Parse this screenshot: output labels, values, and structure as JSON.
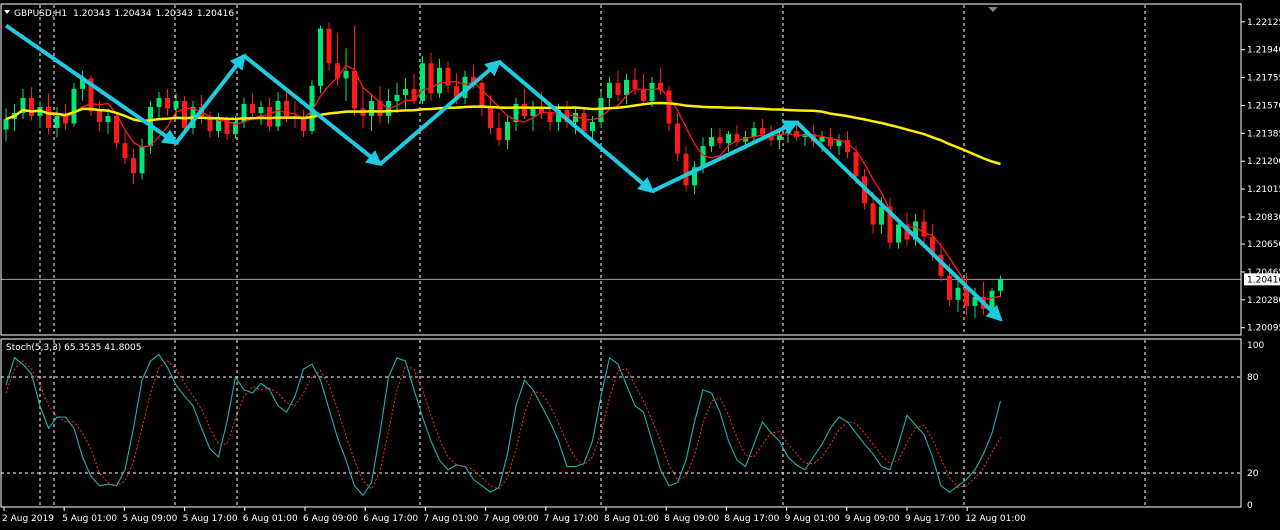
{
  "chart_data": [
    {
      "type": "candlestick",
      "title": "GBPUSD,H1",
      "ohlc_header": [
        "1.20343",
        "1.20434",
        "1.20343",
        "1.20416"
      ],
      "current_price": 1.20416,
      "current_price_label": "1.20416",
      "ylim": [
        1.2006,
        1.2223
      ],
      "y_ticks": [
        {
          "v": 1.22125,
          "label": "1.22125"
        },
        {
          "v": 1.2194,
          "label": "1.21940"
        },
        {
          "v": 1.21755,
          "label": "1.21755"
        },
        {
          "v": 1.2157,
          "label": "1.21570"
        },
        {
          "v": 1.21385,
          "label": "1.21385"
        },
        {
          "v": 1.212,
          "label": "1.21200"
        },
        {
          "v": 1.21015,
          "label": "1.21015"
        },
        {
          "v": 1.2083,
          "label": "1.20830"
        },
        {
          "v": 1.2065,
          "label": "1.20650"
        },
        {
          "v": 1.20465,
          "label": "1.20465"
        },
        {
          "v": 1.2028,
          "label": "1.20280"
        },
        {
          "v": 1.20095,
          "label": "1.20095"
        }
      ],
      "x_labels": [
        "2 Aug 2019",
        "5 Aug 01:00",
        "5 Aug 09:00",
        "5 Aug 17:00",
        "6 Aug 01:00",
        "6 Aug 09:00",
        "6 Aug 17:00",
        "7 Aug 01:00",
        "7 Aug 09:00",
        "7 Aug 17:00",
        "8 Aug 01:00",
        "8 Aug 09:00",
        "8 Aug 17:00",
        "9 Aug 01:00",
        "9 Aug 09:00",
        "9 Aug 17:00",
        "12 Aug 01:00"
      ],
      "candles": [
        [
          1.2141,
          1.2155,
          1.2133,
          1.2148
        ],
        [
          1.2148,
          1.2158,
          1.214,
          1.2152
        ],
        [
          1.2152,
          1.2168,
          1.2148,
          1.2162
        ],
        [
          1.2162,
          1.2169,
          1.2147,
          1.215
        ],
        [
          1.215,
          1.216,
          1.2142,
          1.2156
        ],
        [
          1.2156,
          1.2165,
          1.2138,
          1.2142
        ],
        [
          1.2142,
          1.2156,
          1.2136,
          1.215
        ],
        [
          1.215,
          1.2158,
          1.2141,
          1.2145
        ],
        [
          1.2145,
          1.2172,
          1.2143,
          1.2168
        ],
        [
          1.2168,
          1.218,
          1.216,
          1.2175
        ],
        [
          1.2175,
          1.2177,
          1.215,
          1.2153
        ],
        [
          1.2153,
          1.216,
          1.214,
          1.2146
        ],
        [
          1.2146,
          1.2155,
          1.2138,
          1.215
        ],
        [
          1.215,
          1.2152,
          1.2128,
          1.2132
        ],
        [
          1.2132,
          1.214,
          1.2118,
          1.2122
        ],
        [
          1.2122,
          1.2128,
          1.2105,
          1.2112
        ],
        [
          1.2112,
          1.2135,
          1.2108,
          1.213
        ],
        [
          1.213,
          1.216,
          1.2125,
          1.2156
        ],
        [
          1.2156,
          1.2166,
          1.2148,
          1.2162
        ],
        [
          1.2162,
          1.2168,
          1.215,
          1.2155
        ],
        [
          1.2155,
          1.2165,
          1.2148,
          1.216
        ],
        [
          1.216,
          1.2163,
          1.2138,
          1.2142
        ],
        [
          1.2142,
          1.216,
          1.2138,
          1.2156
        ],
        [
          1.2156,
          1.2164,
          1.2145,
          1.215
        ],
        [
          1.215,
          1.2153,
          1.2136,
          1.214
        ],
        [
          1.214,
          1.2152,
          1.2136,
          1.2148
        ],
        [
          1.2148,
          1.215,
          1.2134,
          1.2138
        ],
        [
          1.2138,
          1.215,
          1.2135,
          1.2146
        ],
        [
          1.2146,
          1.2162,
          1.2142,
          1.2158
        ],
        [
          1.2158,
          1.2165,
          1.2148,
          1.2152
        ],
        [
          1.2152,
          1.216,
          1.2144,
          1.2156
        ],
        [
          1.2156,
          1.2162,
          1.214,
          1.2143
        ],
        [
          1.2143,
          1.2166,
          1.214,
          1.216
        ],
        [
          1.216,
          1.2166,
          1.2146,
          1.215
        ],
        [
          1.215,
          1.216,
          1.2142,
          1.2148
        ],
        [
          1.2148,
          1.2154,
          1.2136,
          1.214
        ],
        [
          1.214,
          1.2174,
          1.2138,
          1.217
        ],
        [
          1.217,
          1.221,
          1.2165,
          1.2208
        ],
        [
          1.2208,
          1.2212,
          1.218,
          1.2185
        ],
        [
          1.2185,
          1.2205,
          1.217,
          1.2175
        ],
        [
          1.2175,
          1.2195,
          1.216,
          1.218
        ],
        [
          1.218,
          1.221,
          1.215,
          1.2155
        ],
        [
          1.2155,
          1.217,
          1.2142,
          1.215
        ],
        [
          1.215,
          1.2165,
          1.214,
          1.216
        ],
        [
          1.216,
          1.217,
          1.2145,
          1.215
        ],
        [
          1.215,
          1.2168,
          1.2145,
          1.216
        ],
        [
          1.216,
          1.2172,
          1.2152,
          1.2164
        ],
        [
          1.2164,
          1.2175,
          1.2155,
          1.2168
        ],
        [
          1.2168,
          1.2178,
          1.2158,
          1.216
        ],
        [
          1.216,
          1.219,
          1.2158,
          1.2185
        ],
        [
          1.2185,
          1.2192,
          1.216,
          1.2165
        ],
        [
          1.2165,
          1.2188,
          1.2162,
          1.2182
        ],
        [
          1.2182,
          1.2186,
          1.2165,
          1.217
        ],
        [
          1.217,
          1.2178,
          1.2158,
          1.2162
        ],
        [
          1.2162,
          1.218,
          1.2158,
          1.2176
        ],
        [
          1.2176,
          1.2184,
          1.2168,
          1.2172
        ],
        [
          1.2172,
          1.2176,
          1.215,
          1.2156
        ],
        [
          1.2156,
          1.2164,
          1.2138,
          1.2142
        ],
        [
          1.2142,
          1.2152,
          1.213,
          1.2134
        ],
        [
          1.2134,
          1.215,
          1.2128,
          1.2146
        ],
        [
          1.2146,
          1.2162,
          1.214,
          1.2158
        ],
        [
          1.2158,
          1.2168,
          1.2148,
          1.215
        ],
        [
          1.215,
          1.216,
          1.214,
          1.2156
        ],
        [
          1.2156,
          1.2166,
          1.2148,
          1.2152
        ],
        [
          1.2152,
          1.2158,
          1.214,
          1.2146
        ],
        [
          1.2146,
          1.2158,
          1.214,
          1.2154
        ],
        [
          1.2154,
          1.216,
          1.2142,
          1.2146
        ],
        [
          1.2146,
          1.2156,
          1.2138,
          1.2152
        ],
        [
          1.2152,
          1.2155,
          1.2136,
          1.214
        ],
        [
          1.214,
          1.215,
          1.2134,
          1.2146
        ],
        [
          1.2146,
          1.2166,
          1.2142,
          1.2162
        ],
        [
          1.2162,
          1.2176,
          1.2156,
          1.2172
        ],
        [
          1.2172,
          1.218,
          1.216,
          1.2164
        ],
        [
          1.2164,
          1.2178,
          1.2158,
          1.2174
        ],
        [
          1.2174,
          1.2182,
          1.2164,
          1.2168
        ],
        [
          1.2168,
          1.2178,
          1.2158,
          1.216
        ],
        [
          1.216,
          1.2176,
          1.2156,
          1.2172
        ],
        [
          1.2172,
          1.2182,
          1.2164,
          1.2167
        ],
        [
          1.2167,
          1.217,
          1.214,
          1.2145
        ],
        [
          1.2145,
          1.2152,
          1.212,
          1.2125
        ],
        [
          1.2125,
          1.213,
          1.21,
          1.2104
        ],
        [
          1.2104,
          1.212,
          1.2098,
          1.2116
        ],
        [
          1.2116,
          1.2136,
          1.2112,
          1.213
        ],
        [
          1.213,
          1.2142,
          1.2126,
          1.2136
        ],
        [
          1.2136,
          1.2142,
          1.2128,
          1.2132
        ],
        [
          1.2132,
          1.214,
          1.2126,
          1.2138
        ],
        [
          1.2138,
          1.2144,
          1.213,
          1.2133
        ],
        [
          1.2133,
          1.214,
          1.2128,
          1.2136
        ],
        [
          1.2136,
          1.2146,
          1.2132,
          1.2142
        ],
        [
          1.2142,
          1.2148,
          1.2134,
          1.2138
        ],
        [
          1.2138,
          1.2144,
          1.213,
          1.2134
        ],
        [
          1.2134,
          1.2142,
          1.2128,
          1.2138
        ],
        [
          1.2138,
          1.2146,
          1.2132,
          1.214
        ],
        [
          1.214,
          1.2146,
          1.2134,
          1.2136
        ],
        [
          1.2136,
          1.2142,
          1.213,
          1.2138
        ],
        [
          1.2138,
          1.2144,
          1.213,
          1.2133
        ],
        [
          1.2133,
          1.214,
          1.2126,
          1.2136
        ],
        [
          1.2136,
          1.2142,
          1.2128,
          1.213
        ],
        [
          1.213,
          1.2138,
          1.2124,
          1.2134
        ],
        [
          1.2134,
          1.214,
          1.2122,
          1.2126
        ],
        [
          1.2126,
          1.213,
          1.2105,
          1.211
        ],
        [
          1.211,
          1.2115,
          1.2088,
          1.2092
        ],
        [
          1.2092,
          1.21,
          1.2072,
          1.2078
        ],
        [
          1.2078,
          1.2096,
          1.2072,
          1.209
        ],
        [
          1.209,
          1.2096,
          1.2062,
          1.2066
        ],
        [
          1.2066,
          1.2082,
          1.2062,
          1.2078
        ],
        [
          1.2078,
          1.2086,
          1.2064,
          1.2068
        ],
        [
          1.2068,
          1.2085,
          1.2064,
          1.208
        ],
        [
          1.208,
          1.2088,
          1.2066,
          1.207
        ],
        [
          1.207,
          1.2078,
          1.2054,
          1.2058
        ],
        [
          1.2058,
          1.2066,
          1.204,
          1.2044
        ],
        [
          1.2044,
          1.2052,
          1.2024,
          1.2028
        ],
        [
          1.2028,
          1.2042,
          1.202,
          1.2036
        ],
        [
          1.2036,
          1.2046,
          1.2018,
          1.2024
        ],
        [
          1.2024,
          1.2036,
          1.2016,
          1.203
        ],
        [
          1.203,
          1.204,
          1.2018,
          1.2022
        ],
        [
          1.2022,
          1.2036,
          1.2018,
          1.2034
        ],
        [
          1.2034,
          1.2044,
          1.203,
          1.2042
        ]
      ],
      "zigzag": [
        [
          1.221,
          0
        ],
        [
          1.2132,
          20
        ],
        [
          1.219,
          28
        ],
        [
          1.2118,
          44
        ],
        [
          1.2186,
          58
        ],
        [
          1.21,
          76
        ],
        [
          1.2146,
          93
        ],
        [
          1.2015,
          117
        ]
      ],
      "ma_fast_color": "#ff1a1a",
      "ma_slow_color": "#ffee00",
      "bull_color": "#00e676",
      "bear_color": "#ff1a1a",
      "zigzag_color": "#1ecbe1"
    },
    {
      "type": "line",
      "title": "Stoch(5,3,3) 65.3535 41.8005",
      "ylim": [
        0,
        100
      ],
      "levels": [
        {
          "v": 100,
          "label": "100",
          "line": false
        },
        {
          "v": 80,
          "label": "80",
          "line": true
        },
        {
          "v": 20,
          "label": "20",
          "line": true
        },
        {
          "v": 0,
          "label": "0",
          "line": false
        }
      ],
      "main_color": "#20b2aa",
      "signal_color": "#ff2a2a",
      "main_values": [
        75,
        92,
        88,
        82,
        62,
        48,
        55,
        55,
        48,
        30,
        18,
        12,
        13,
        12,
        22,
        48,
        78,
        90,
        94,
        86,
        75,
        68,
        62,
        48,
        35,
        30,
        52,
        80,
        72,
        70,
        76,
        72,
        62,
        58,
        68,
        85,
        88,
        78,
        60,
        42,
        28,
        12,
        6,
        14,
        45,
        80,
        92,
        90,
        72,
        55,
        40,
        28,
        22,
        25,
        24,
        16,
        12,
        8,
        11,
        32,
        62,
        78,
        72,
        62,
        52,
        40,
        24,
        24,
        26,
        40,
        68,
        92,
        88,
        75,
        62,
        58,
        40,
        22,
        12,
        14,
        28,
        52,
        72,
        70,
        58,
        40,
        28,
        24,
        38,
        52,
        45,
        40,
        30,
        25,
        22,
        30,
        38,
        48,
        55,
        52,
        45,
        38,
        32,
        24,
        22,
        38,
        56,
        50,
        44,
        30,
        12,
        8,
        12,
        16,
        22,
        32,
        45,
        65
      ],
      "signal_values": [
        70,
        85,
        90,
        85,
        75,
        62,
        55,
        52,
        52,
        45,
        35,
        20,
        14,
        12,
        15,
        27,
        48,
        70,
        86,
        90,
        85,
        76,
        68,
        60,
        48,
        38,
        38,
        54,
        68,
        74,
        72,
        73,
        70,
        64,
        62,
        70,
        80,
        84,
        75,
        60,
        43,
        28,
        15,
        10,
        21,
        46,
        72,
        87,
        85,
        72,
        56,
        41,
        30,
        25,
        24,
        22,
        17,
        12,
        10,
        17,
        35,
        57,
        71,
        70,
        62,
        51,
        39,
        29,
        25,
        30,
        45,
        67,
        84,
        85,
        75,
        65,
        53,
        40,
        25,
        16,
        18,
        31,
        51,
        65,
        67,
        56,
        42,
        31,
        30,
        38,
        45,
        46,
        38,
        32,
        26,
        26,
        30,
        38,
        47,
        52,
        51,
        45,
        38,
        31,
        26,
        28,
        39,
        48,
        50,
        41,
        29,
        17,
        11,
        12,
        17,
        23,
        33,
        42
      ]
    }
  ]
}
